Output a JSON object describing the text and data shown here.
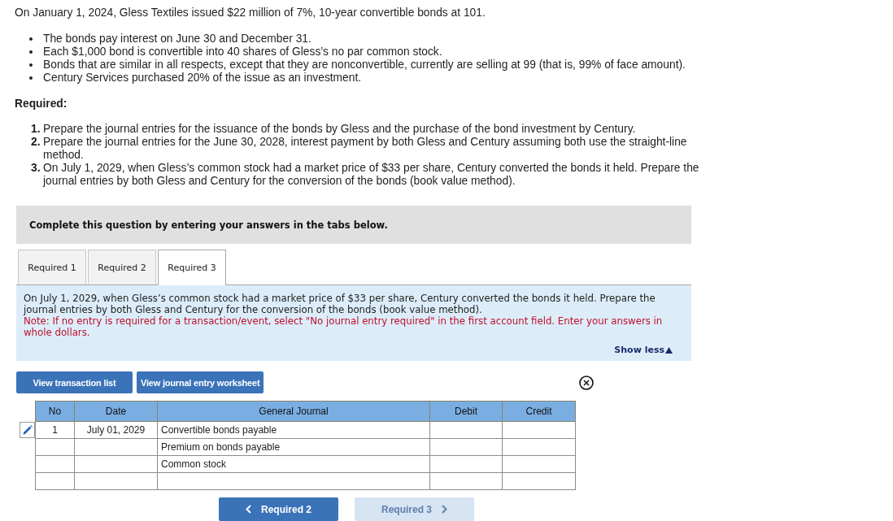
{
  "problem": {
    "intro": "On January 1, 2024, Gless Textiles issued $22 million of 7%, 10-year convertible bonds at 101.",
    "facts": [
      "The bonds pay interest on June 30 and December 31.",
      "Each $1,000 bond is convertible into 40 shares of Gless’s no par common stock.",
      "Bonds that are similar in all respects, except that they are nonconvertible, currently are selling at 99 (that is, 99% of face amount).",
      "Century Services purchased 20% of the issue as an investment."
    ],
    "required_heading": "Required:",
    "requirements": [
      {
        "number": "1.",
        "text": "Prepare the journal entries for the issuance of the bonds by Gless and the purchase of the bond investment by Century."
      },
      {
        "number": "2.",
        "text": "Prepare the journal entries for the June 30, 2028, interest payment by both Gless and Century assuming both use the straight-line method."
      },
      {
        "number": "3.",
        "text": "On July 1, 2029, when Gless’s common stock had a market price of $33 per share, Century converted the bonds it held. Prepare the journal entries by both Gless and Century for the conversion of the bonds (book value method)."
      }
    ]
  },
  "instructions": "Complete this question by entering your answers in the tabs below.",
  "tabs": [
    {
      "label": "Required 1",
      "selected": false
    },
    {
      "label": "Required 2",
      "selected": false
    },
    {
      "label": "Required 3",
      "selected": true
    }
  ],
  "tab_panel": {
    "prompt": "On July 1, 2029, when Gless’s common stock had a market price of $33 per share, Century converted the bonds it held. Prepare the journal entries by both Gless and Century for the conversion of the bonds (book value method).",
    "note": "Note: If no entry is required for a transaction/event, select \"No journal entry required\" in the first account field. Enter your answers in whole dollars.",
    "toggle": "Show less"
  },
  "toolbar": {
    "buttons": [
      "View transaction list",
      "View journal entry worksheet"
    ]
  },
  "journal": {
    "columns": [
      "No",
      "Date",
      "General Journal",
      "Debit",
      "Credit"
    ],
    "rows": [
      {
        "no": "1",
        "date": "July 01, 2029",
        "account": "Convertible bonds payable",
        "editable": true
      },
      {
        "account": "Premium on bonds payable",
        "editable": false
      },
      {
        "account": "Common stock",
        "editable": false
      },
      {
        "editable": false
      }
    ]
  },
  "navigation": [
    {
      "kind": "previous",
      "label": "Required 2",
      "disabled": false
    },
    {
      "kind": "next",
      "label": "Required 3",
      "disabled": true
    }
  ]
}
